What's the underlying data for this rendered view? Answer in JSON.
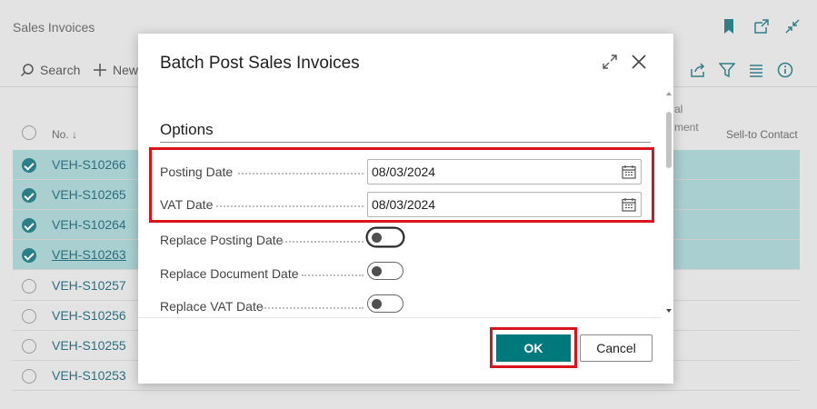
{
  "background": {
    "page_title": "Sales Invoices",
    "actions": {
      "search": "Search",
      "new": "New"
    },
    "columns": {
      "no": "No. ↓",
      "fragment_top": "al",
      "fragment_bottom": "ment",
      "sell_to": "Sell-to Contact"
    },
    "rows": [
      {
        "no": "VEH-S10266",
        "selected": true
      },
      {
        "no": "VEH-S10265",
        "selected": true
      },
      {
        "no": "VEH-S10264",
        "selected": true
      },
      {
        "no": "VEH-S10263",
        "selected": true
      },
      {
        "no": "VEH-S10257",
        "selected": false
      },
      {
        "no": "VEH-S10256",
        "selected": false
      },
      {
        "no": "VEH-S10255",
        "selected": false
      },
      {
        "no": "VEH-S10253",
        "selected": false
      }
    ]
  },
  "dialog": {
    "title": "Batch Post Sales Invoices",
    "section_title": "Options",
    "fields": {
      "posting_date": {
        "label": "Posting Date",
        "value": "08/03/2024"
      },
      "vat_date": {
        "label": "VAT Date",
        "value": "08/03/2024"
      },
      "replace_posting_date": {
        "label": "Replace Posting Date",
        "on": false
      },
      "replace_document_date": {
        "label": "Replace Document Date",
        "on": false
      },
      "replace_vat_date": {
        "label": "Replace VAT Date",
        "on": false
      }
    },
    "buttons": {
      "ok": "OK",
      "cancel": "Cancel"
    }
  },
  "colors": {
    "accent": "#00797c",
    "highlight": "#d9141c",
    "selected_row": "#a9cfd0"
  }
}
